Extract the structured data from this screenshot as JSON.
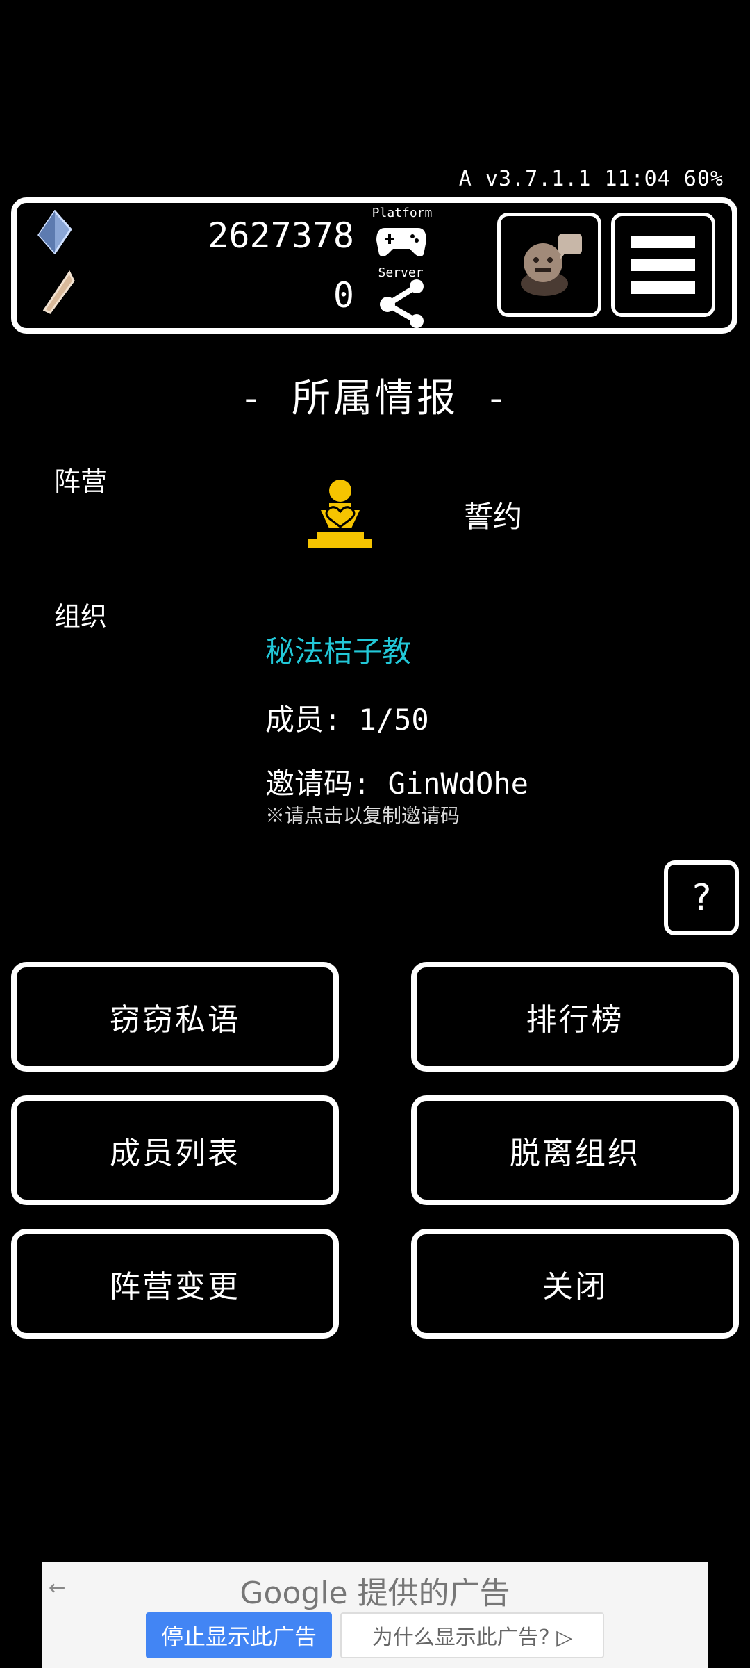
{
  "status_bar": {
    "text": "A v3.7.1.1 11:04 60%"
  },
  "hud": {
    "currency1_value": "2627378",
    "currency2_value": "0",
    "platform_label": "Platform",
    "server_label": "Server"
  },
  "page": {
    "title": "- 所属情报 -",
    "faction_label": "阵营",
    "faction_name": "誓约",
    "org_label": "组织",
    "org_name": "秘法桔子教",
    "members": "成员: 1/50",
    "invite_code": "邀请码: GinWdOhe",
    "copy_hint": "※请点击以复制邀请码",
    "help": "?"
  },
  "buttons": {
    "whisper": "窃窃私语",
    "ranking": "排行榜",
    "member_list": "成员列表",
    "leave_org": "脱离组织",
    "change_faction": "阵营变更",
    "close": "关闭"
  },
  "ad": {
    "back": "←",
    "title": "Google 提供的广告",
    "stop": "停止显示此广告",
    "why": "为什么显示此广告? ▷"
  },
  "colors": {
    "accent_cyan": "#22c8d8",
    "faction_yellow": "#f6c400",
    "ad_blue": "#4285f4"
  }
}
